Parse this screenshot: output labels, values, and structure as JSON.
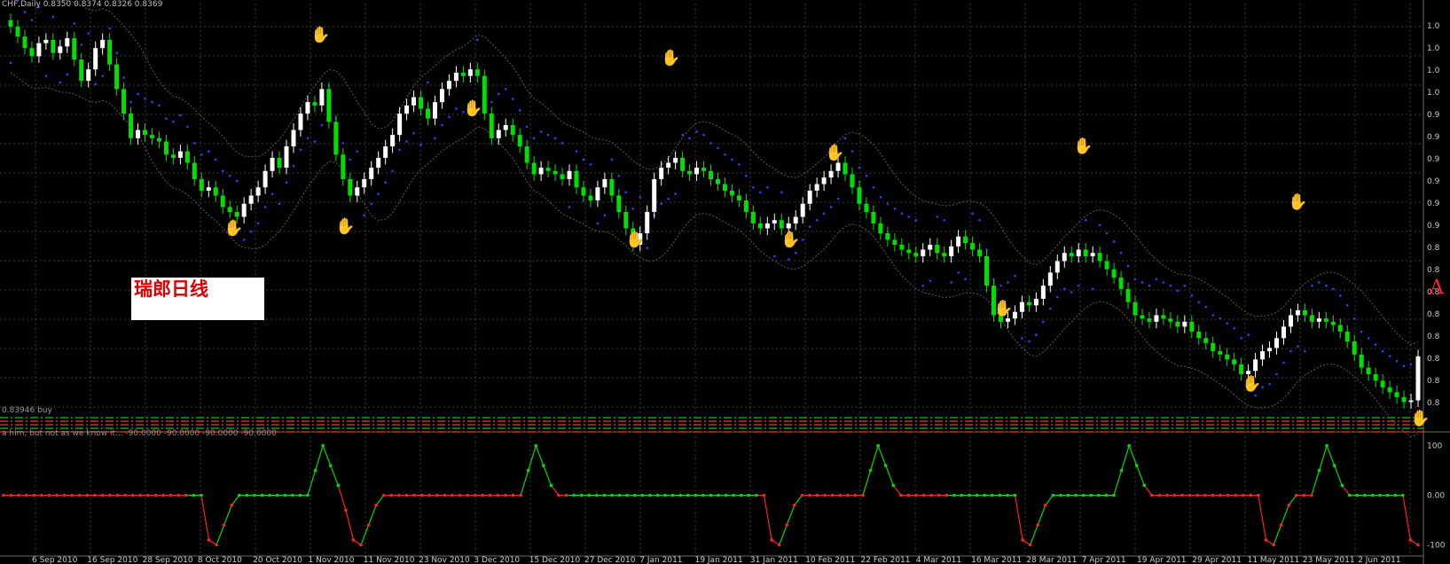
{
  "header": {
    "title": "CHF,Daily",
    "ohlc": "0.8350 0.8374 0.8326 0.8369"
  },
  "caption": "瑞郎日线",
  "marker": "A",
  "buy_line": "0.83946 buy",
  "indicator_header": "a him, but not as we know it...  -90.0000 -90.0000 -90.0000 -90.0000",
  "price_axis": [
    "1.0",
    "1.0",
    "1.0",
    "1.0",
    "0.9",
    "0.9",
    "0.9",
    "0.9",
    "0.9",
    "0.9",
    "0.8",
    "0.8",
    "0.8",
    "0.8",
    "0.8",
    "0.8",
    "0.8",
    "0.8"
  ],
  "indicator_axis": [
    "100",
    "0.00",
    "-100"
  ],
  "date_labels": [
    "6 Sep 2010",
    "16 Sep 2010",
    "28 Sep 2010",
    "8 Oct 2010",
    "20 Oct 2010",
    "1 Nov 2010",
    "11 Nov 2010",
    "23 Nov 2010",
    "3 Dec 2010",
    "15 Dec 2010",
    "27 Dec 2010",
    "7 Jan 2011",
    "19 Jan 2011",
    "31 Jan 2011",
    "10 Feb 2011",
    "22 Feb 2011",
    "4 Mar 2011",
    "16 Mar 2011",
    "28 Mar 2011",
    "7 Apr 2011",
    "19 Apr 2011",
    "29 Apr 2011",
    "11 May 2011",
    "23 May 2011",
    "2 Jun 2011"
  ],
  "chart_data": {
    "type": "candlestick",
    "title": "CHF,Daily",
    "colors": {
      "up": "#ffffff",
      "down": "#00e000",
      "parabolic_sar": "#3a3aff",
      "sell_marker": "#ff2020",
      "buy_marker": "#2aa0ff",
      "osc_up": "#00dd00",
      "osc_down": "#ff2020",
      "grid": "#3a3a3a"
    },
    "closes": [
      1.038,
      1.032,
      1.025,
      1.02,
      1.028,
      1.03,
      1.022,
      1.026,
      1.031,
      1.018,
      1.005,
      1.012,
      1.025,
      1.03,
      1.015,
      1.0,
      0.985,
      0.97,
      0.975,
      0.972,
      0.97,
      0.968,
      0.96,
      0.958,
      0.962,
      0.955,
      0.945,
      0.938,
      0.94,
      0.935,
      0.928,
      0.925,
      0.922,
      0.93,
      0.935,
      0.94,
      0.95,
      0.958,
      0.952,
      0.965,
      0.975,
      0.985,
      0.992,
      0.99,
      1.0,
      0.98,
      0.96,
      0.945,
      0.935,
      0.94,
      0.945,
      0.952,
      0.958,
      0.965,
      0.972,
      0.985,
      0.99,
      0.995,
      0.988,
      0.982,
      0.992,
      1.0,
      1.005,
      1.01,
      1.008,
      1.012,
      1.008,
      0.985,
      0.97,
      0.975,
      0.978,
      0.972,
      0.965,
      0.955,
      0.948,
      0.952,
      0.95,
      0.948,
      0.945,
      0.95,
      0.94,
      0.935,
      0.932,
      0.94,
      0.945,
      0.935,
      0.925,
      0.915,
      0.905,
      0.912,
      0.925,
      0.945,
      0.952,
      0.955,
      0.958,
      0.95,
      0.948,
      0.952,
      0.95,
      0.945,
      0.942,
      0.938,
      0.935,
      0.932,
      0.925,
      0.918,
      0.915,
      0.918,
      0.92,
      0.915,
      0.918,
      0.922,
      0.93,
      0.938,
      0.942,
      0.946,
      0.95,
      0.955,
      0.948,
      0.94,
      0.93,
      0.925,
      0.918,
      0.912,
      0.908,
      0.905,
      0.902,
      0.9,
      0.898,
      0.902,
      0.905,
      0.9,
      0.898,
      0.904,
      0.91,
      0.906,
      0.902,
      0.898,
      0.88,
      0.862,
      0.858,
      0.86,
      0.864,
      0.87,
      0.868,
      0.872,
      0.88,
      0.888,
      0.895,
      0.9,
      0.898,
      0.902,
      0.898,
      0.9,
      0.895,
      0.89,
      0.885,
      0.878,
      0.87,
      0.862,
      0.86,
      0.858,
      0.862,
      0.86,
      0.858,
      0.855,
      0.858,
      0.852,
      0.848,
      0.845,
      0.84,
      0.838,
      0.835,
      0.832,
      0.826,
      0.828,
      0.835,
      0.84,
      0.842,
      0.848,
      0.855,
      0.862,
      0.865,
      0.862,
      0.858,
      0.86,
      0.858,
      0.856,
      0.852,
      0.846,
      0.838,
      0.83,
      0.826,
      0.822,
      0.818,
      0.815,
      0.812,
      0.809,
      0.81,
      0.8369
    ],
    "sar_sells": [
      1.03,
      0.985,
      1.016,
      0.958,
      0.962,
      0.928,
      0.905,
      0.882
    ],
    "sar_buys": [
      0.925,
      0.926,
      0.918,
      0.918,
      0.876,
      0.83,
      0.809
    ],
    "oscillator": [
      0,
      0,
      0,
      0,
      0,
      0,
      0,
      0,
      0,
      0,
      0,
      0,
      0,
      0,
      0,
      0,
      0,
      0,
      0,
      0,
      0,
      0,
      0,
      0,
      0,
      0,
      0,
      -90,
      -100,
      -60,
      -20,
      0,
      0,
      0,
      0,
      0,
      0,
      0,
      0,
      0,
      0,
      50,
      100,
      60,
      20,
      -30,
      -90,
      -100,
      -60,
      -20,
      0,
      0,
      0,
      0,
      0,
      0,
      0,
      0,
      0,
      0,
      0,
      0,
      0,
      0,
      0,
      0,
      0,
      0,
      0,
      50,
      100,
      60,
      20,
      0,
      0,
      0,
      0,
      0,
      0,
      0,
      0,
      0,
      0,
      0,
      0,
      0,
      0,
      0,
      0,
      0,
      0,
      0,
      0,
      0,
      0,
      0,
      0,
      0,
      0,
      0,
      0,
      -90,
      -100,
      -60,
      -20,
      0,
      0,
      0,
      0,
      0,
      0,
      0,
      0,
      0,
      50,
      100,
      60,
      20,
      0,
      0,
      0,
      0,
      0,
      0,
      0,
      0,
      0,
      0,
      0,
      0,
      0,
      0,
      0,
      0,
      -90,
      -100,
      -60,
      -20,
      0,
      0,
      0,
      0,
      0,
      0,
      0,
      0,
      0,
      50,
      100,
      60,
      20,
      0,
      0,
      0,
      0,
      0,
      0,
      0,
      0,
      0,
      0,
      0,
      0,
      0,
      0,
      0,
      -90,
      -100,
      -60,
      -20,
      0,
      0,
      0,
      50,
      100,
      60,
      20,
      0,
      0,
      0,
      0,
      0,
      0,
      0,
      0,
      -90,
      -100
    ],
    "ylim": [
      0.8,
      1.05
    ],
    "osc_ylim": [
      -110,
      110
    ],
    "xlabel": "",
    "ylabel": ""
  }
}
